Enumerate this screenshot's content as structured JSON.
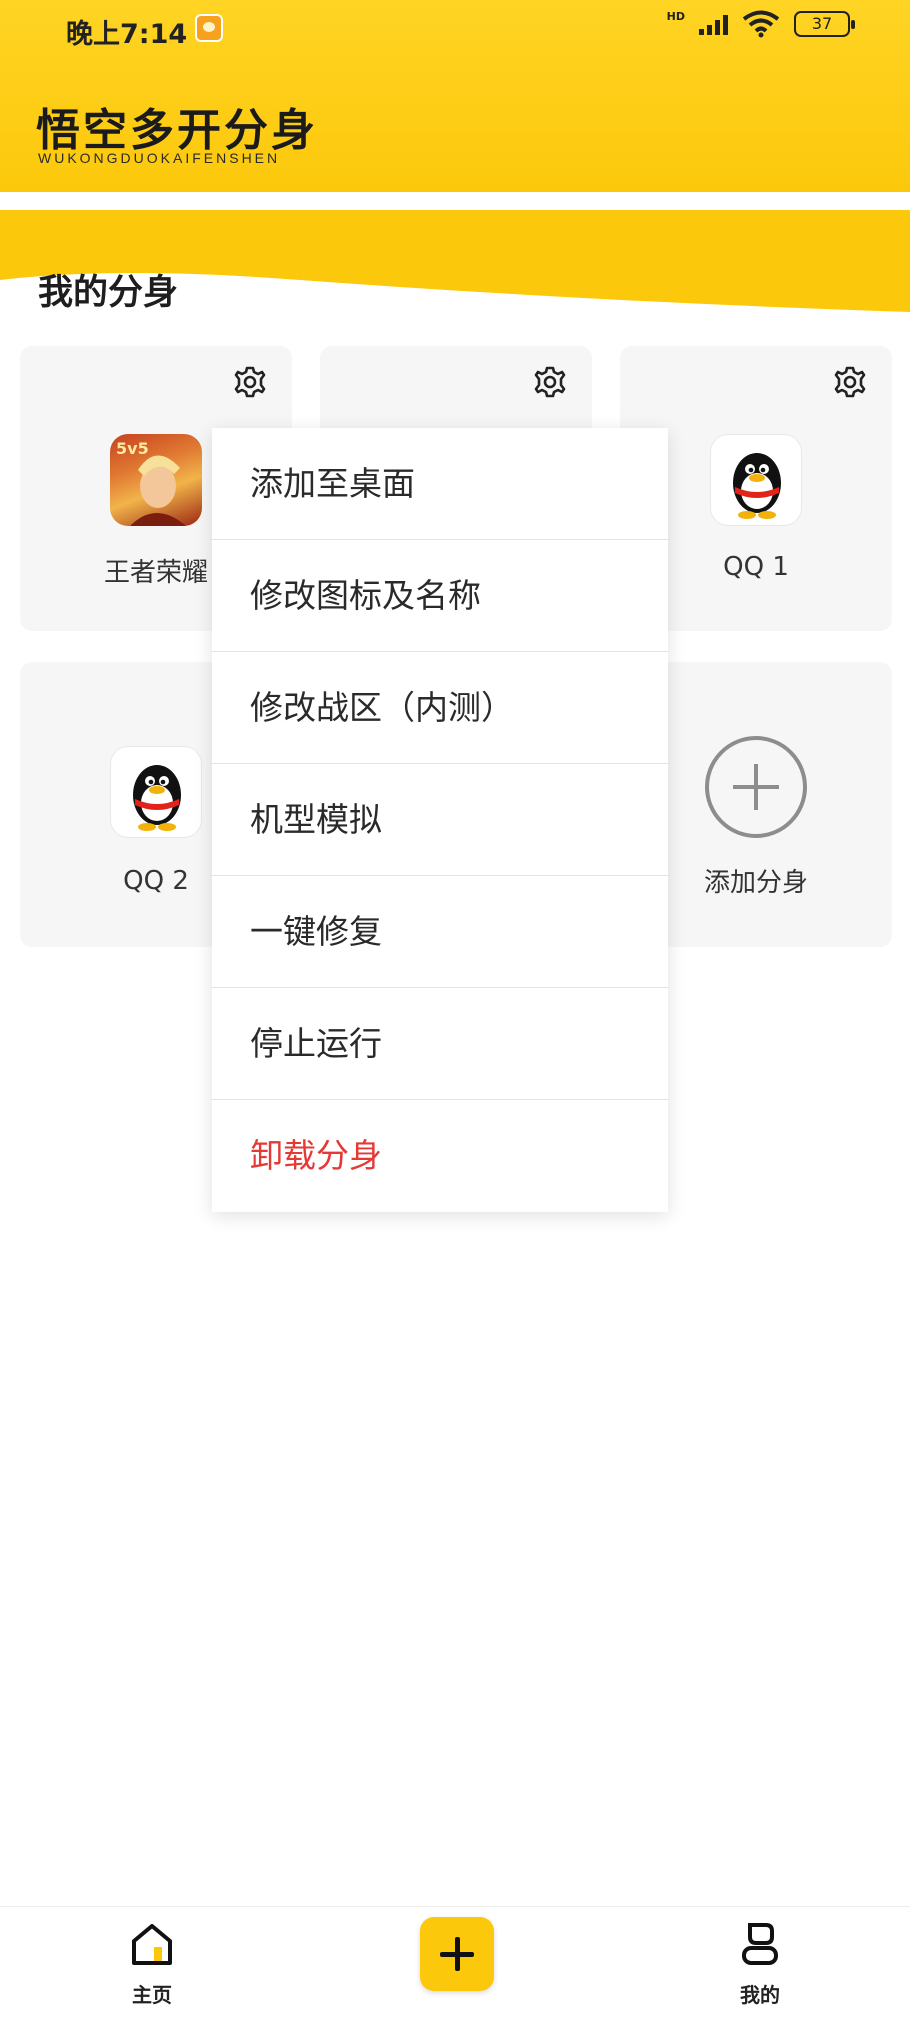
{
  "status_bar": {
    "time": "晚上7:14",
    "network": "HD",
    "battery": "37"
  },
  "header": {
    "title": "悟空多开分身",
    "subtitle": "WUKONGDUOKAIFENSHEN",
    "accent_color": "#fcc80b"
  },
  "section": {
    "title": "我的分身"
  },
  "apps": [
    {
      "name": "王者荣耀",
      "icon": "honor-of-kings-icon"
    },
    {
      "name": "",
      "icon": "hidden-app-icon"
    },
    {
      "name": "QQ  1",
      "icon": "qq-penguin-icon"
    },
    {
      "name": "QQ  2",
      "icon": "qq-penguin-icon"
    },
    {
      "name": "",
      "icon": "hidden-app-icon"
    }
  ],
  "add_clone": {
    "label": "添加分身"
  },
  "context_menu": {
    "items": [
      {
        "label": "添加至桌面"
      },
      {
        "label": "修改图标及名称"
      },
      {
        "label": "修改战区（内测）"
      },
      {
        "label": "机型模拟"
      },
      {
        "label": "一键修复"
      },
      {
        "label": "停止运行"
      },
      {
        "label": "卸载分身",
        "color": "#e53935"
      }
    ]
  },
  "bottom_nav": {
    "home_label": "主页",
    "mine_label": "我的"
  }
}
